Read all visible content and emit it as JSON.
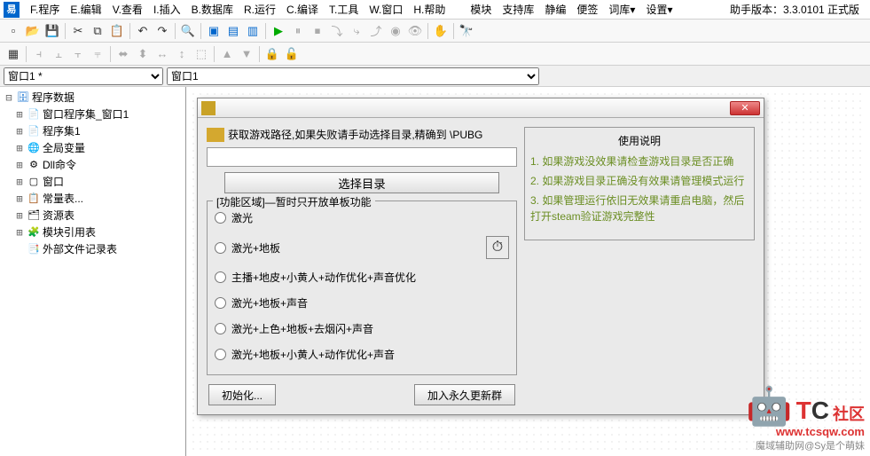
{
  "menubar": {
    "items": [
      "F.程序",
      "E.编辑",
      "V.查看",
      "I.插入",
      "B.数据库",
      "R.运行",
      "C.编译",
      "T.工具",
      "W.窗口",
      "H.帮助",
      "模块",
      "支持库",
      "静编",
      "便签",
      "词库▾",
      "设置▾"
    ],
    "version": "助手版本：3.3.0101 正式版"
  },
  "dropdowns": {
    "dd1": "窗口1 *",
    "dd2": "窗口1"
  },
  "tree": {
    "root": "程序数据",
    "items": [
      {
        "label": "窗口程序集_窗口1",
        "icon": "module"
      },
      {
        "label": "程序集1",
        "icon": "module"
      },
      {
        "label": "全局变量",
        "icon": "var"
      },
      {
        "label": "Dll命令",
        "icon": "dll"
      },
      {
        "label": "窗口",
        "icon": "window"
      },
      {
        "label": "常量表...",
        "icon": "const"
      },
      {
        "label": "资源表",
        "icon": "res"
      },
      {
        "label": "模块引用表",
        "icon": "mod"
      },
      {
        "label": "外部文件记录表",
        "icon": "ext"
      }
    ]
  },
  "form": {
    "title": "",
    "path_label": "获取游戏路径,如果失败请手动选择目录,精确到 \\PUBG",
    "select_dir": "选择目录",
    "fieldset_legend": "[功能区域]—暂时只开放单板功能",
    "radios": [
      "激光",
      "激光+地板",
      "主播+地皮+小黄人+动作优化+声音优化",
      "激光+地板+声音",
      "激光+上色+地板+去烟闪+声音",
      "激光+地板+小黄人+动作优化+声音"
    ],
    "init_btn": "初始化...",
    "join_btn": "加入永久更新群",
    "help": {
      "title": "使用说明",
      "lines": [
        "1. 如果游戏没效果请检查游戏目录是否正确",
        "2. 如果游戏目录正确没有效果请管理模式运行",
        "3. 如果管理运行依旧无效果请重启电脑，然后打开steam验证游戏完整性"
      ]
    }
  },
  "watermark": {
    "brand_suffix": "社区",
    "url": "www.tcsqw.com",
    "small": "魔域辅助网@Sy是个萌妹"
  }
}
